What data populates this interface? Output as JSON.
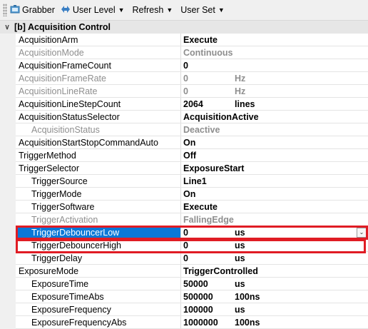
{
  "toolbar": {
    "grabber": "Grabber",
    "user_level": "User Level",
    "refresh": "Refresh",
    "user_set": "User Set"
  },
  "category": {
    "title": "[b] Acquisition Control",
    "toggle": "∨"
  },
  "rows": [
    {
      "name": "AcquisitionArm",
      "value": "Execute",
      "unit": "",
      "indent": 0,
      "state": "normal"
    },
    {
      "name": "AcquisitionMode",
      "value": "Continuous",
      "unit": "",
      "indent": 0,
      "state": "disabled"
    },
    {
      "name": "AcquisitionFrameCount",
      "value": "0",
      "unit": "",
      "indent": 0,
      "state": "normal"
    },
    {
      "name": "AcquisitionFrameRate",
      "value": "0",
      "unit": "Hz",
      "indent": 0,
      "state": "disabled"
    },
    {
      "name": "AcquisitionLineRate",
      "value": "0",
      "unit": "Hz",
      "indent": 0,
      "state": "disabled"
    },
    {
      "name": "AcquisitionLineStepCount",
      "value": "2064",
      "unit": "lines",
      "indent": 0,
      "state": "normal"
    },
    {
      "name": "AcquisitionStatusSelector",
      "value": "AcquisitionActive",
      "unit": "",
      "indent": 0,
      "state": "normal"
    },
    {
      "name": "AcquisitionStatus",
      "value": "Deactive",
      "unit": "",
      "indent": 1,
      "state": "disabled"
    },
    {
      "name": "AcquisitionStartStopCommandAuto",
      "value": "On",
      "unit": "",
      "indent": 0,
      "state": "normal"
    },
    {
      "name": "TriggerMethod",
      "value": "Off",
      "unit": "",
      "indent": 0,
      "state": "normal"
    },
    {
      "name": "TriggerSelector",
      "value": "ExposureStart",
      "unit": "",
      "indent": 0,
      "state": "normal"
    },
    {
      "name": "TriggerSource",
      "value": "Line1",
      "unit": "",
      "indent": 1,
      "state": "normal"
    },
    {
      "name": "TriggerMode",
      "value": "On",
      "unit": "",
      "indent": 1,
      "state": "normal"
    },
    {
      "name": "TriggerSoftware",
      "value": "Execute",
      "unit": "",
      "indent": 1,
      "state": "normal"
    },
    {
      "name": "TriggerActivation",
      "value": "FallingEdge",
      "unit": "",
      "indent": 1,
      "state": "disabled"
    },
    {
      "name": "TriggerDebouncerLow",
      "value": "0",
      "unit": "us",
      "indent": 1,
      "state": "selected"
    },
    {
      "name": "TriggerDebouncerHigh",
      "value": "0",
      "unit": "us",
      "indent": 1,
      "state": "normal"
    },
    {
      "name": "TriggerDelay",
      "value": "0",
      "unit": "us",
      "indent": 1,
      "state": "normal"
    },
    {
      "name": "ExposureMode",
      "value": "TriggerControlled",
      "unit": "",
      "indent": 0,
      "state": "normal"
    },
    {
      "name": "ExposureTime",
      "value": "50000",
      "unit": "us",
      "indent": 1,
      "state": "normal"
    },
    {
      "name": "ExposureTimeAbs",
      "value": "500000",
      "unit": "100ns",
      "indent": 1,
      "state": "normal"
    },
    {
      "name": "ExposureFrequency",
      "value": "100000",
      "unit": "us",
      "indent": 1,
      "state": "normal"
    },
    {
      "name": "ExposureFrequencyAbs",
      "value": "1000000",
      "unit": "100ns",
      "indent": 1,
      "state": "normal"
    }
  ],
  "colors": {
    "highlight_box": "#e01c24",
    "selection": "#0a78d7"
  }
}
